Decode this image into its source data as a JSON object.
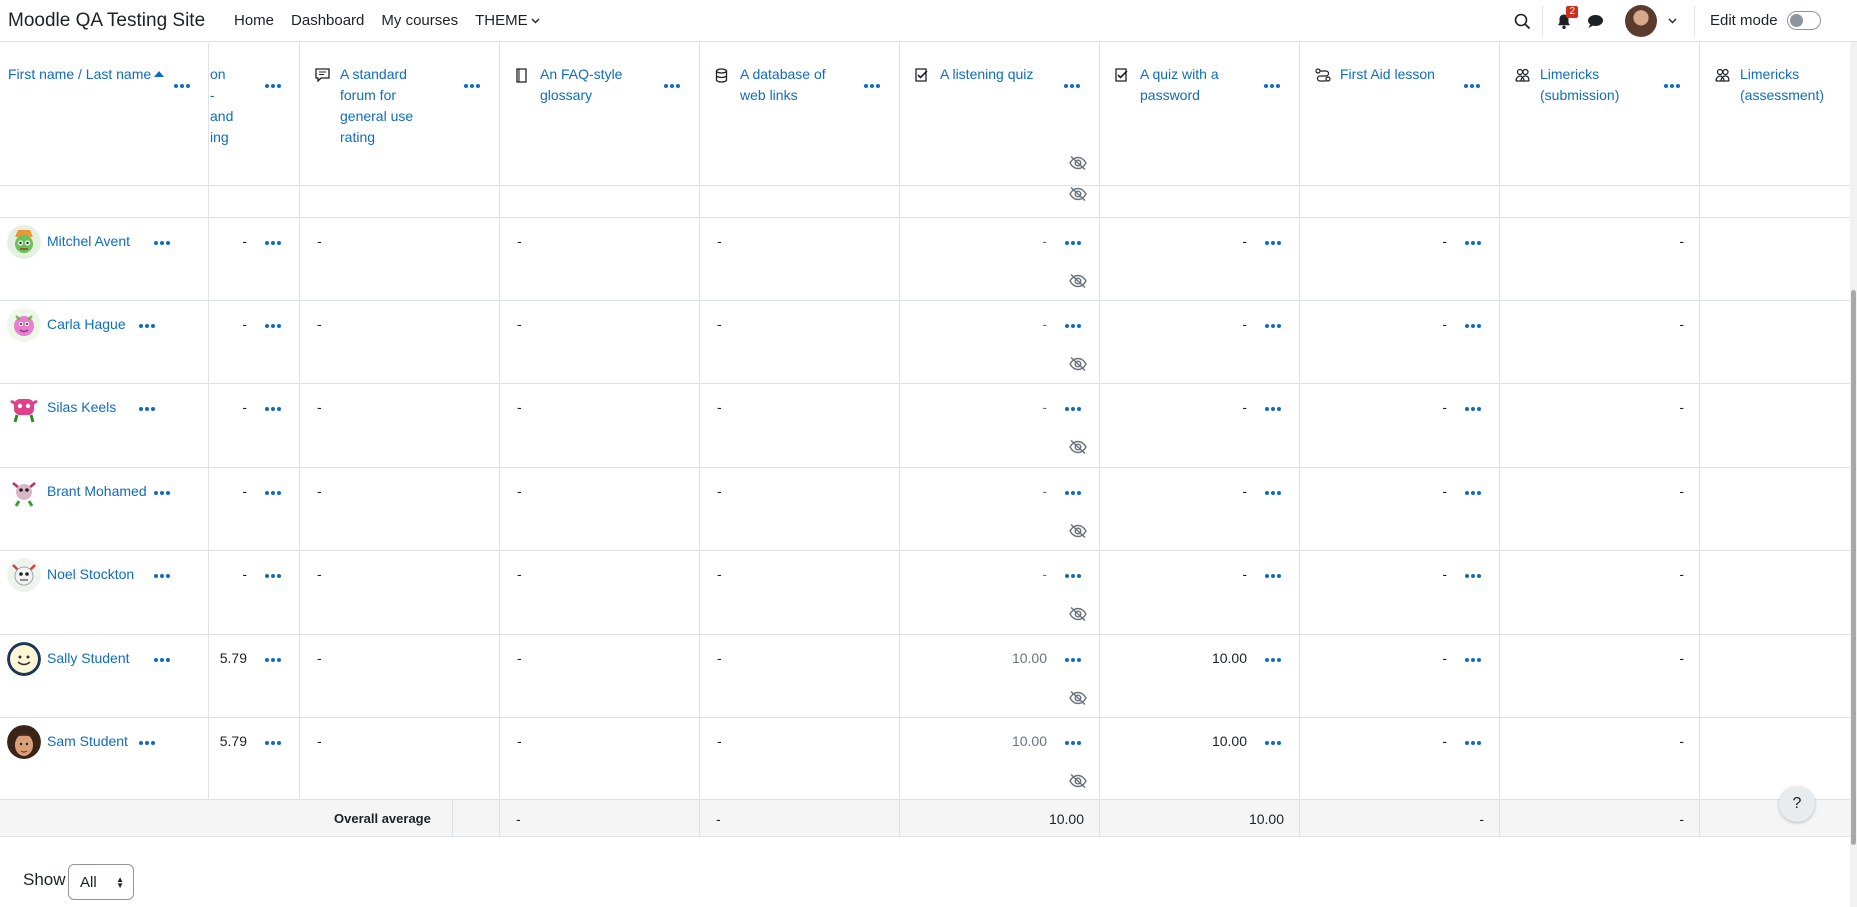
{
  "navbar": {
    "brand": "Moodle QA Testing Site",
    "links": [
      "Home",
      "Dashboard",
      "My courses",
      "THEME"
    ],
    "notification_count": "2",
    "edit_mode_label": "Edit mode"
  },
  "columns": {
    "name_header": "First name / Last name",
    "partial_header": [
      "on",
      "-",
      "and",
      "ing"
    ],
    "items": [
      {
        "lines": [
          "A standard",
          "forum for",
          "general use",
          "rating"
        ],
        "icon": "forum-icon"
      },
      {
        "lines": [
          "An FAQ-style",
          "glossary"
        ],
        "icon": "glossary-icon"
      },
      {
        "lines": [
          "A database of",
          "web links"
        ],
        "icon": "database-icon"
      },
      {
        "lines": [
          "A listening quiz"
        ],
        "icon": "quiz-icon"
      },
      {
        "lines": [
          "A quiz with a",
          "password"
        ],
        "icon": "quiz-icon"
      },
      {
        "lines": [
          "First Aid lesson"
        ],
        "icon": "lesson-icon"
      },
      {
        "lines": [
          "Limericks",
          "(submission)"
        ],
        "icon": "workshop-icon"
      },
      {
        "lines": [
          "Limericks",
          "(assessment)"
        ],
        "icon": "workshop-icon"
      }
    ]
  },
  "students": [
    {
      "name": "Mitchel Avent",
      "total": "-",
      "forum": "-",
      "glossary": "-",
      "database": "-",
      "listening": "-",
      "password_quiz": "-",
      "lesson": "-",
      "limericks_sub": "-"
    },
    {
      "name": "Carla Hague",
      "total": "-",
      "forum": "-",
      "glossary": "-",
      "database": "-",
      "listening": "-",
      "password_quiz": "-",
      "lesson": "-",
      "limericks_sub": "-"
    },
    {
      "name": "Silas Keels",
      "total": "-",
      "forum": "-",
      "glossary": "-",
      "database": "-",
      "listening": "-",
      "password_quiz": "-",
      "lesson": "-",
      "limericks_sub": "-"
    },
    {
      "name": "Brant Mohamed",
      "total": "-",
      "forum": "-",
      "glossary": "-",
      "database": "-",
      "listening": "-",
      "password_quiz": "-",
      "lesson": "-",
      "limericks_sub": "-"
    },
    {
      "name": "Noel Stockton",
      "total": "-",
      "forum": "-",
      "glossary": "-",
      "database": "-",
      "listening": "-",
      "password_quiz": "-",
      "lesson": "-",
      "limericks_sub": "-"
    },
    {
      "name": "Sally Student",
      "total": "5.79",
      "forum": "-",
      "glossary": "-",
      "database": "-",
      "listening": "10.00",
      "password_quiz": "10.00",
      "lesson": "-",
      "limericks_sub": "-"
    },
    {
      "name": "Sam Student",
      "total": "5.79",
      "forum": "-",
      "glossary": "-",
      "database": "-",
      "listening": "10.00",
      "password_quiz": "10.00",
      "lesson": "-",
      "limericks_sub": "-"
    }
  ],
  "overall": {
    "label": "Overall average",
    "forum": "-",
    "database": "-",
    "listening": "10.00",
    "password_quiz": "10.00",
    "lesson": "-",
    "limericks_sub": "-"
  },
  "footer": {
    "show_label": "Show",
    "show_value": "All"
  },
  "help_label": "?"
}
